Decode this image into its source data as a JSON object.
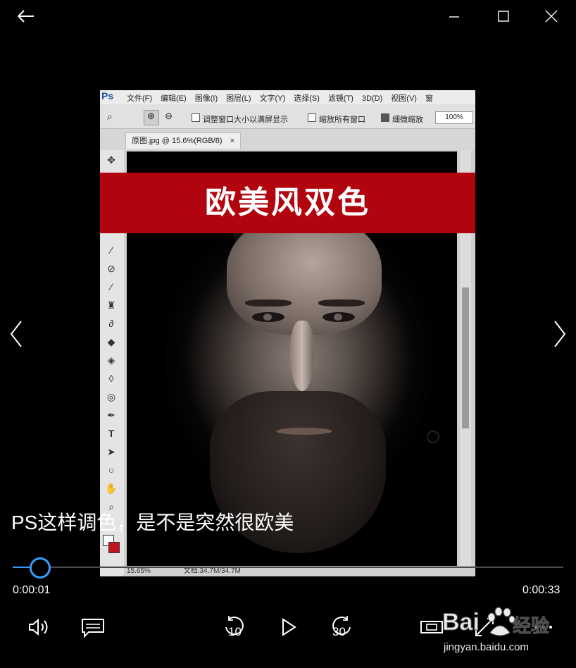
{
  "window": {
    "icons": {
      "back": "back-arrow-icon",
      "minimize": "minimize-icon",
      "maximize": "maximize-icon",
      "close": "close-icon"
    }
  },
  "video_frame": {
    "ps_logo": "Ps",
    "menus": [
      "文件(F)",
      "编辑(E)",
      "图像(I)",
      "图层(L)",
      "文字(Y)",
      "选择(S)",
      "滤镜(T)",
      "3D(D)",
      "视图(V)",
      "窗"
    ],
    "options": {
      "fit_window": "调整窗口大小以满屏显示",
      "zoom_all": "缩放所有窗口",
      "scrubby_zoom": "细微缩放",
      "zoom_percent": "100%"
    },
    "tab_title": "原图.jpg @ 15.6%(RGB/8)",
    "tab_close": "×",
    "status_zoom": "15.65%",
    "status_doc": "文档:34.7M/34.7M",
    "banner_text": "欧美风双色",
    "banner_color": "#b1040e"
  },
  "caption": "PS这样调色，是不是突然很欧美",
  "player": {
    "progress": 0.03,
    "elapsed": "0:00:01",
    "duration": "0:00:33",
    "skip_back_seconds": "10",
    "skip_forward_seconds": "30",
    "accent_color": "#3a9bff",
    "controls": [
      "volume-icon",
      "subtitles-icon",
      "skip-back-10-icon",
      "play-icon",
      "skip-forward-30-icon",
      "aspect-ratio-icon",
      "fullscreen-icon",
      "more-icon"
    ]
  },
  "watermark": {
    "brand_text": "Bai",
    "brand_suffix": "经验",
    "url": "jingyan.baidu.com"
  }
}
